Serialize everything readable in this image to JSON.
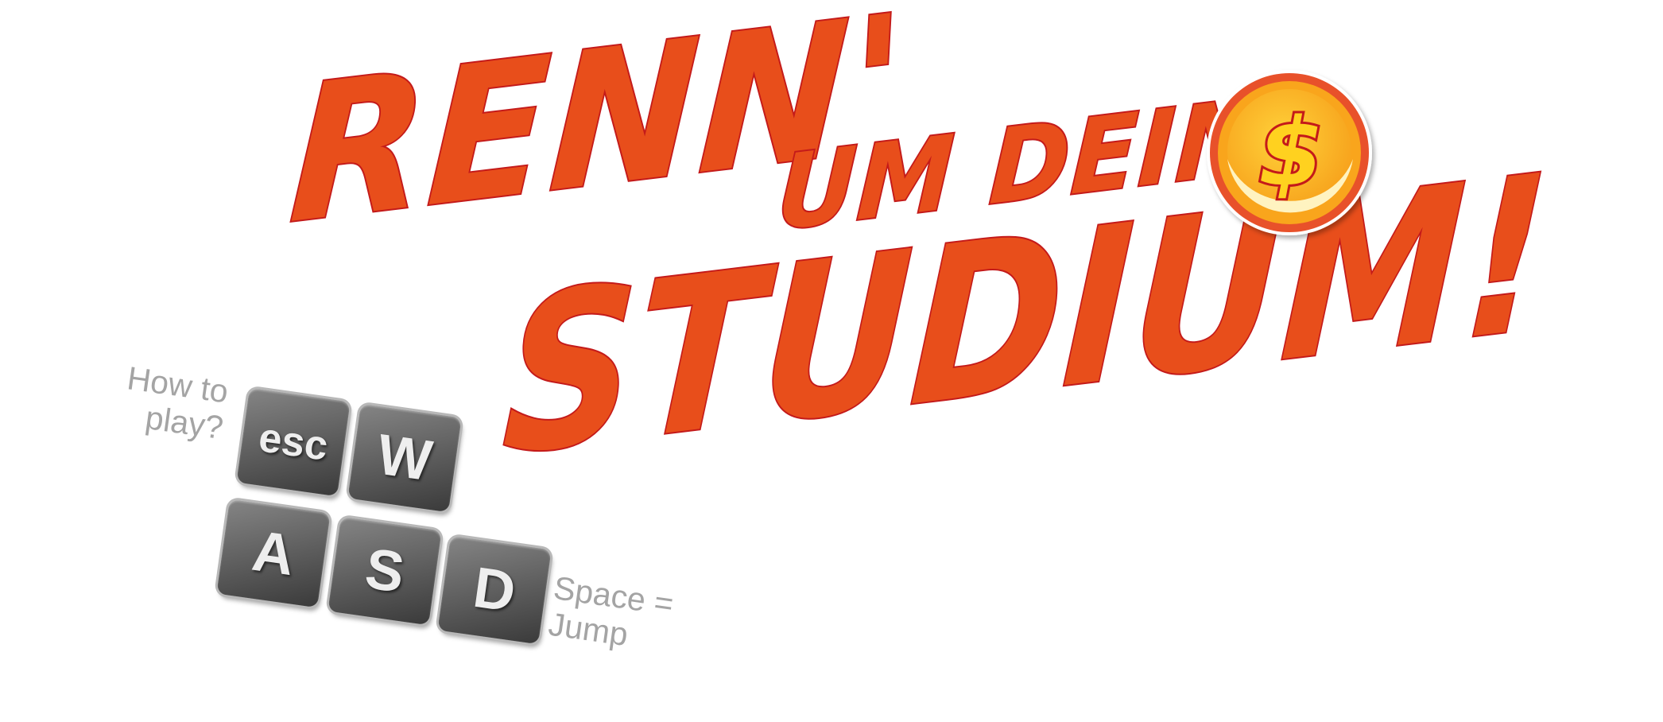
{
  "title": {
    "line1_big": "RENN'",
    "line1_small": "UM DEIN",
    "line2": "STUDIUM!"
  },
  "coin": {
    "symbol": "$",
    "icon": "dollar-coin-icon"
  },
  "controls": {
    "question": "How to play?",
    "keys": {
      "esc": "esc",
      "w": "W",
      "a": "A",
      "s": "S",
      "d": "D"
    },
    "jump_hint": "Space = Jump"
  },
  "colors": {
    "title_fill": "#e84e1b",
    "title_stroke": "#c41a1a",
    "coin_outer": "#e8512a",
    "coin_inner": "#f9b31d",
    "key_gray": "#4a4a4a",
    "hint_text": "#a4a4a4"
  }
}
